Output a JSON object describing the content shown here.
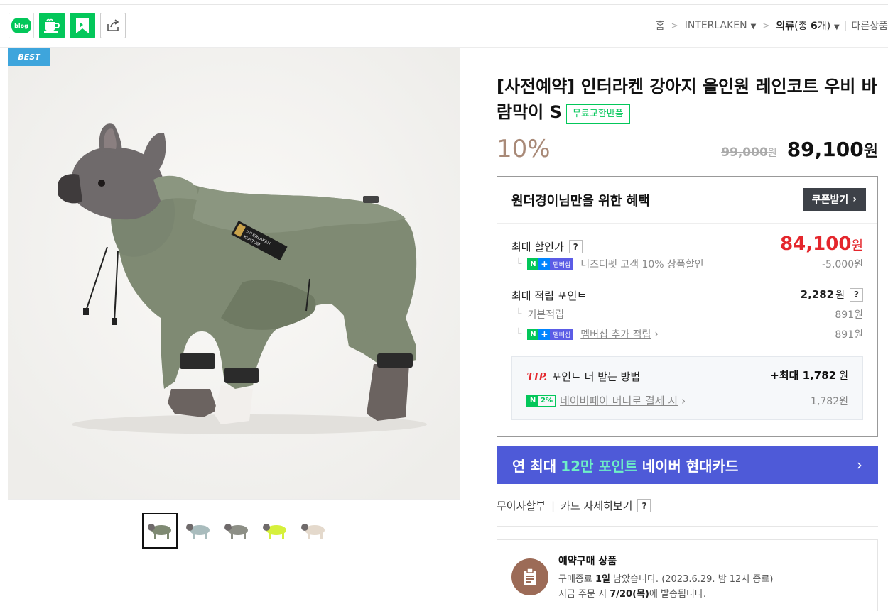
{
  "share": {
    "blog_label": "blog",
    "icons": [
      "blog-icon",
      "cafe-icon",
      "bookmark-icon",
      "share-icon"
    ]
  },
  "breadcrumb": {
    "home": "홈",
    "brand": "INTERLAKEN",
    "category": "의류",
    "count_prefix": "(총 ",
    "count_num": "6",
    "count_suffix": "개)",
    "other": "다른상품"
  },
  "image": {
    "badge": "BEST",
    "garment_text_1": "INTERLAKEN",
    "garment_text_2": "KUSTOM",
    "thumbnail_count": 5
  },
  "product": {
    "title": "[사전예약] 인터라켄 강아지 올인원 레인코트 우비 바람막이 S",
    "tag": "무료교환반품",
    "discount": "10%",
    "original_price": "99,000",
    "original_unit": "원",
    "final_price": "89,100",
    "final_unit": "원"
  },
  "benefit": {
    "title": "원더경이님만을 위한 혜택",
    "coupon_button": "쿠폰받기",
    "max_discount_label": "최대 할인가",
    "max_discount_price": "84,100",
    "max_discount_unit": "원",
    "membership_badge": "멤버십",
    "member_discount_text": "니즈더펫 고객 10% 상품할인",
    "member_discount_value": "-5,000원",
    "max_point_label": "최대 적립 포인트",
    "max_point_value": "2,282",
    "max_point_unit": "원",
    "basic_point_label": "기본적립",
    "basic_point_value": "891원",
    "membership_point_label": "멤버십 추가 적립",
    "membership_point_value": "891원"
  },
  "tip": {
    "tip_word": "TIP.",
    "title": "포인트 더 받는 방법",
    "max_prefix": "+최대",
    "max_value": "1,782",
    "max_unit": "원",
    "pct_badge": "2%",
    "naverpay_text": "네이버페이 머니로 결제 시",
    "naverpay_value": "1,782원"
  },
  "card_banner": {
    "pre": "연 최대",
    "highlight": "12만 포인트",
    "post": "네이버 현대카드"
  },
  "installment": {
    "label": "무이자할부",
    "card_detail": "카드 자세히보기"
  },
  "preorder": {
    "title": "예약구매 상품",
    "line1_pre": "구매종료 ",
    "line1_bold": "1일",
    "line1_post": " 남았습니다. (2023.6.29. 밤 12시 종료)",
    "line2_pre": "지금 주문 시 ",
    "line2_bold": "7/20(목)",
    "line2_post": "에 발송됩니다."
  },
  "colors": {
    "naver_green": "#03c75a",
    "sale_red": "#e4262c",
    "card_blue": "#4e5ad8",
    "jacket_green": "#7f8a73",
    "best_blue": "#3ea5dc"
  }
}
